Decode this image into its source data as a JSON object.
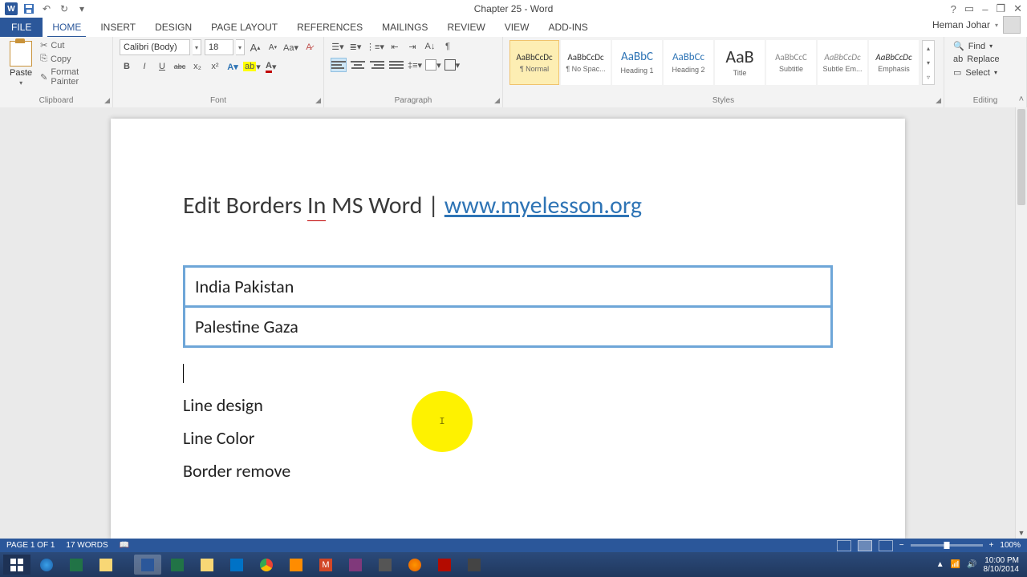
{
  "app": {
    "title": "Chapter 25 - Word"
  },
  "qat": {
    "save": "Save",
    "undo": "Undo",
    "redo": "Redo"
  },
  "window": {
    "help": "?",
    "ribbon_opts": "▭",
    "minimize": "–",
    "restore": "❐",
    "close": "✕"
  },
  "tabs": {
    "file": "FILE",
    "items": [
      "HOME",
      "INSERT",
      "DESIGN",
      "PAGE LAYOUT",
      "REFERENCES",
      "MAILINGS",
      "REVIEW",
      "VIEW",
      "ADD-INS"
    ],
    "active": "HOME"
  },
  "account": {
    "name": "Heman Johar"
  },
  "ribbon": {
    "clipboard": {
      "label": "Clipboard",
      "paste": "Paste",
      "cut": "Cut",
      "copy": "Copy",
      "format_painter": "Format Painter"
    },
    "font": {
      "label": "Font",
      "name": "Calibri (Body)",
      "size": "18",
      "bold": "B",
      "italic": "I",
      "underline": "U",
      "strike": "abc",
      "sub": "x₂",
      "sup": "x²",
      "grow": "A",
      "shrink": "A",
      "case": "Aa",
      "clear": "A"
    },
    "paragraph": {
      "label": "Paragraph"
    },
    "styles": {
      "label": "Styles",
      "items": [
        {
          "preview": "AaBbCcDc",
          "name": "¶ Normal",
          "sel": true,
          "fs": "11",
          "col": "#333"
        },
        {
          "preview": "AaBbCcDc",
          "name": "¶ No Spac...",
          "fs": "11",
          "col": "#333"
        },
        {
          "preview": "AaBbC",
          "name": "Heading 1",
          "fs": "15",
          "col": "#2e74b5"
        },
        {
          "preview": "AaBbCc",
          "name": "Heading 2",
          "fs": "13",
          "col": "#2e74b5"
        },
        {
          "preview": "AaB",
          "name": "Title",
          "fs": "22",
          "col": "#333"
        },
        {
          "preview": "AaBbCcC",
          "name": "Subtitle",
          "fs": "11",
          "col": "#888"
        },
        {
          "preview": "AaBbCcDc",
          "name": "Subtle Em...",
          "fs": "11",
          "col": "#888",
          "italic": true
        },
        {
          "preview": "AaBbCcDc",
          "name": "Emphasis",
          "fs": "11",
          "col": "#333",
          "italic": true
        }
      ]
    },
    "editing": {
      "label": "Editing",
      "find": "Find",
      "replace": "Replace",
      "select": "Select"
    }
  },
  "document": {
    "heading_prefix": "Edit Borders ",
    "heading_in": "In",
    "heading_rest": " MS Word | ",
    "heading_link": "www.myelesson.org",
    "bordered": [
      "India Pakistan",
      "Palestine Gaza"
    ],
    "lines": [
      "Line design",
      "Line Color",
      "Border remove"
    ],
    "highlight_char": "I"
  },
  "status": {
    "page": "PAGE 1 OF 1",
    "words": "17 WORDS",
    "zoom": "100%",
    "zoom_minus": "−",
    "zoom_plus": "+"
  },
  "taskbar": {
    "time": "10:00 PM",
    "date": "8/10/2014"
  }
}
